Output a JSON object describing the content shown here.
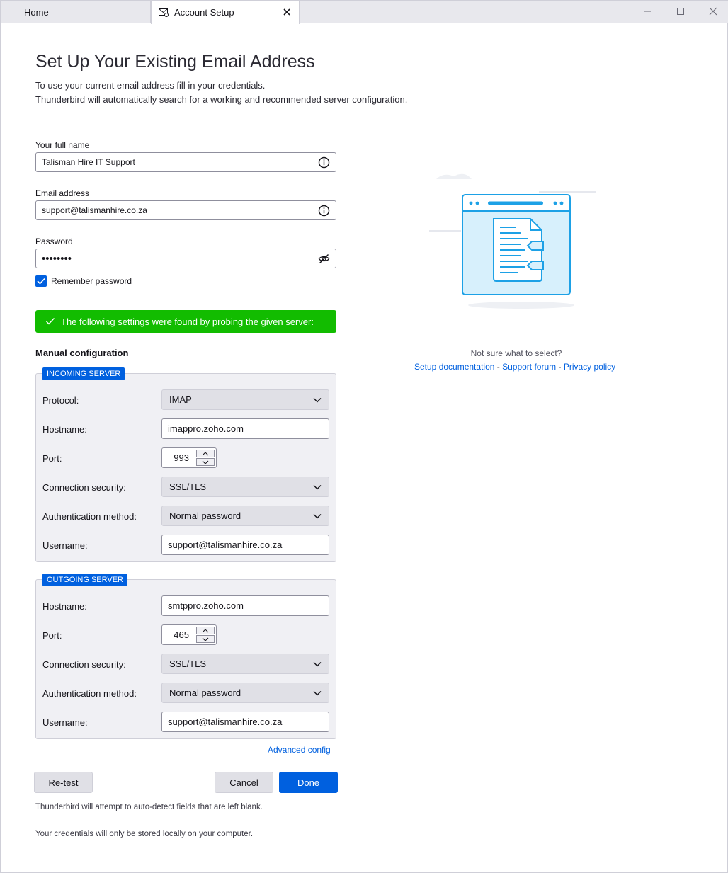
{
  "tabs": [
    {
      "label": "Home"
    },
    {
      "label": "Account Setup",
      "icon": "mail-gear-icon",
      "active": true
    }
  ],
  "window_controls": [
    "minimize-icon",
    "maximize-icon",
    "close-icon"
  ],
  "page": {
    "title": "Set Up Your Existing Email Address",
    "intro_line1": "To use your current email address fill in your credentials.",
    "intro_line2": "Thunderbird will automatically search for a working and recommended server configuration."
  },
  "form": {
    "full_name_label": "Your full name",
    "full_name_value": "Talisman Hire IT Support",
    "email_label": "Email address",
    "email_value": "support@talismanhire.co.za",
    "password_label": "Password",
    "password_value": "••••••••",
    "remember_label": "Remember password",
    "remember_checked": true
  },
  "found_banner": "The following settings were found by probing the given server:",
  "manual": {
    "title": "Manual configuration",
    "incoming": {
      "legend": "INCOMING SERVER",
      "protocol_label": "Protocol:",
      "protocol_value": "IMAP",
      "hostname_label": "Hostname:",
      "hostname_value": "imappro.zoho.com",
      "port_label": "Port:",
      "port_value": "993",
      "security_label": "Connection security:",
      "security_value": "SSL/TLS",
      "auth_label": "Authentication method:",
      "auth_value": "Normal password",
      "username_label": "Username:",
      "username_value": "support@talismanhire.co.za"
    },
    "outgoing": {
      "legend": "OUTGOING SERVER",
      "hostname_label": "Hostname:",
      "hostname_value": "smtppro.zoho.com",
      "port_label": "Port:",
      "port_value": "465",
      "security_label": "Connection security:",
      "security_value": "SSL/TLS",
      "auth_label": "Authentication method:",
      "auth_value": "Normal password",
      "username_label": "Username:",
      "username_value": "support@talismanhire.co.za"
    },
    "advanced_config": "Advanced config"
  },
  "buttons": {
    "retest": "Re-test",
    "cancel": "Cancel",
    "done": "Done"
  },
  "notes": {
    "autodetect": "Thunderbird will attempt to auto-detect fields that are left blank.",
    "local": "Your credentials will only be stored locally on your computer."
  },
  "help": {
    "question": "Not sure what to select?",
    "setup_docs": "Setup documentation",
    "sep1": " - ",
    "support_forum": "Support forum",
    "sep2": " - ",
    "privacy_policy": "Privacy policy"
  },
  "colors": {
    "accent": "#0060df",
    "success": "#12bc00"
  }
}
